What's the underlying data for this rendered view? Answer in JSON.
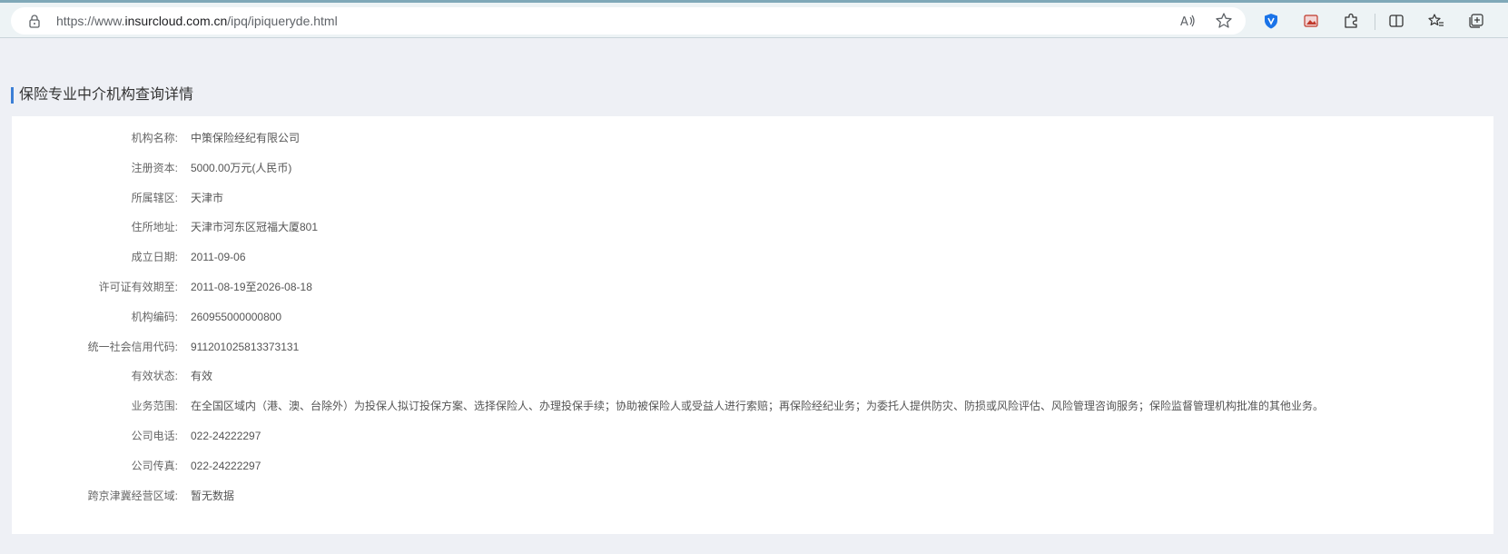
{
  "browser": {
    "url_prefix": "https://www.",
    "url_host": "insurcloud.com.cn",
    "url_path": "/ipq/ipiqueryde.html"
  },
  "page": {
    "section_title": "保险专业中介机构查询详情"
  },
  "details": [
    {
      "label": "机构名称:",
      "value": "中策保险经纪有限公司"
    },
    {
      "label": "注册资本:",
      "value": "5000.00万元(人民币)"
    },
    {
      "label": "所属辖区:",
      "value": "天津市"
    },
    {
      "label": "住所地址:",
      "value": "天津市河东区冠福大厦801"
    },
    {
      "label": "成立日期:",
      "value": "2011-09-06"
    },
    {
      "label": "许可证有效期至:",
      "value": "2011-08-19至2026-08-18"
    },
    {
      "label": "机构编码:",
      "value": "260955000000800"
    },
    {
      "label": "统一社会信用代码:",
      "value": "911201025813373131"
    },
    {
      "label": "有效状态:",
      "value": "有效"
    },
    {
      "label": "业务范围:",
      "value": "在全国区域内（港、澳、台除外）为投保人拟订投保方案、选择保险人、办理投保手续；协助被保险人或受益人进行索赔；再保险经纪业务；为委托人提供防灾、防损或风险评估、风险管理咨询服务；保险监督管理机构批准的其他业务。"
    },
    {
      "label": "公司电话:",
      "value": "022-24222297"
    },
    {
      "label": "公司传真:",
      "value": "022-24222297"
    },
    {
      "label": "跨京津冀经营区域:",
      "value": "暂无数据"
    }
  ],
  "colors": {
    "accent": "#3b7fd6",
    "page_bg": "#eef0f5",
    "card_bg": "#ffffff"
  },
  "icons": {
    "lock": "lock-icon",
    "read_aloud": "read-aloud-icon",
    "favorite": "star-icon",
    "shield": "shield-extension-icon",
    "image": "image-extension-icon",
    "extensions": "puzzle-icon",
    "split": "split-screen-icon",
    "favorites": "favorites-list-icon",
    "collections": "collections-icon"
  }
}
